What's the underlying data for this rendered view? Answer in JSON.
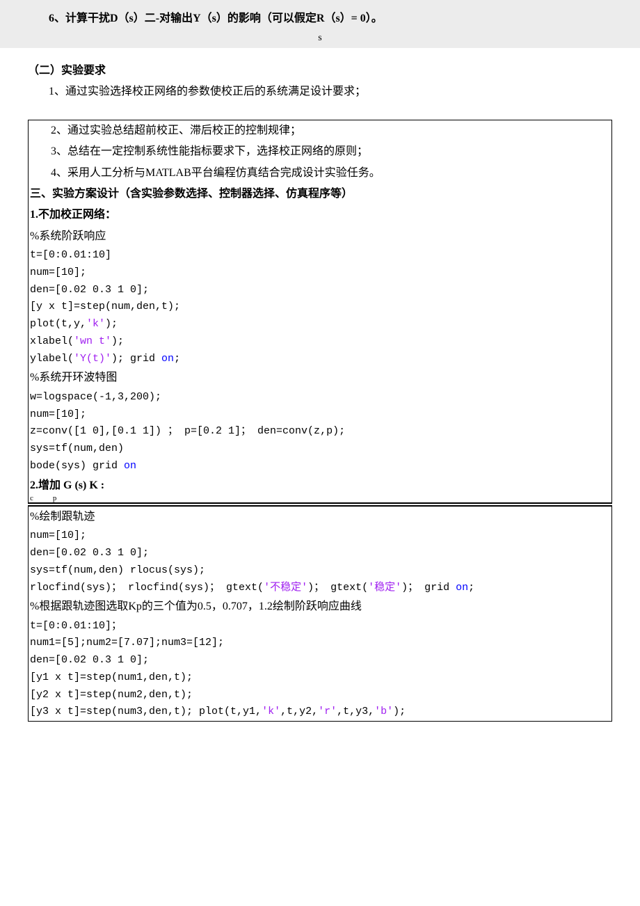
{
  "header": {
    "item6": "6、计算干扰D（s）二-对输出Y（s）的影响（可以假定R（s）= 0）。",
    "s": "s"
  },
  "req": {
    "title": "（二）实验要求",
    "i1": "1、通过实验选择校正网络的参数使校正后的系统满足设计要求；"
  },
  "box1": {
    "i2": "2、通过实验总结超前校正、滞后校正的控制规律；",
    "i3": "3、总结在一定控制系统性能指标要求下，选择校正网络的原则；",
    "i4": "4、采用人工分析与MATLAB平台编程仿真结合完成设计实验任务。",
    "h3": "三、实验方案设计（含实验参数选择、控制器选择、仿真程序等）",
    "s1_title": "1.不加校正网络：",
    "s1_c1": "%系统阶跃响应",
    "s1_l1": "t=[0:0.01:10]",
    "s1_l2": "num=[10];",
    "s1_l3": "den=[0.02 0.3 1 0];",
    "s1_l4": "[y x t]=step(num,den,t);",
    "s1_l5a": "plot(t,y,",
    "s1_l5b": "'k'",
    "s1_l5c": ");",
    "s1_l6a": "xlabel(",
    "s1_l6b": "'wn t'",
    "s1_l6c": ");",
    "s1_l7a": "ylabel(",
    "s1_l7b": "'Y(t)'",
    "s1_l7c": "); grid ",
    "s1_l7d": "on",
    "s1_l7e": ";",
    "s1_c2": "%系统开环波特图",
    "s1_l8": "w=logspace(-1,3,200);",
    "s1_l9": "num=[10];",
    "s1_l10": "z=conv([1 0],[0.1 1]) ； p=[0.2 1]； den=conv(z,p);",
    "s1_l11": "sys=tf(num,den)",
    "s1_l12a": "bode(sys) grid ",
    "s1_l12b": "on",
    "s2_title": "2.增加 G (s) K :",
    "s2_sub": "cp"
  },
  "box2": {
    "c1": "%绘制跟轨迹",
    "l1": "num=[10];",
    "l2": "den=[0.02 0.3 1 0];",
    "l3": "sys=tf(num,den) rlocus(sys);",
    "l4a": "rlocfind(sys)； rlocfind(sys)； gtext(",
    "l4b": "'不稳定'",
    "l4c": ")； gtext(",
    "l4d": "'稳定'",
    "l4e": ")； grid ",
    "l4f": "on",
    "l4g": ";",
    "c2": "%根据跟轨迹图选取Kp的三个值为0.5，0.707，1.2绘制阶跃响应曲线",
    "l5": "t=[0:0.01:10]；",
    "l6": "num1=[5];num2=[7.07];num3=[12];",
    "l7": "den=[0.02 0.3 1 0];",
    "l8": "[y1 x t]=step(num1,den,t);",
    "l9": "[y2 x t]=step(num2,den,t);",
    "l10a": "[y3 x t]=step(num3,den,t); plot(t,y1,",
    "l10b": "'k'",
    "l10c": ",t,y2,",
    "l10d": "'r'",
    "l10e": ",t,y3,",
    "l10f": "'b'",
    "l10g": ");"
  }
}
